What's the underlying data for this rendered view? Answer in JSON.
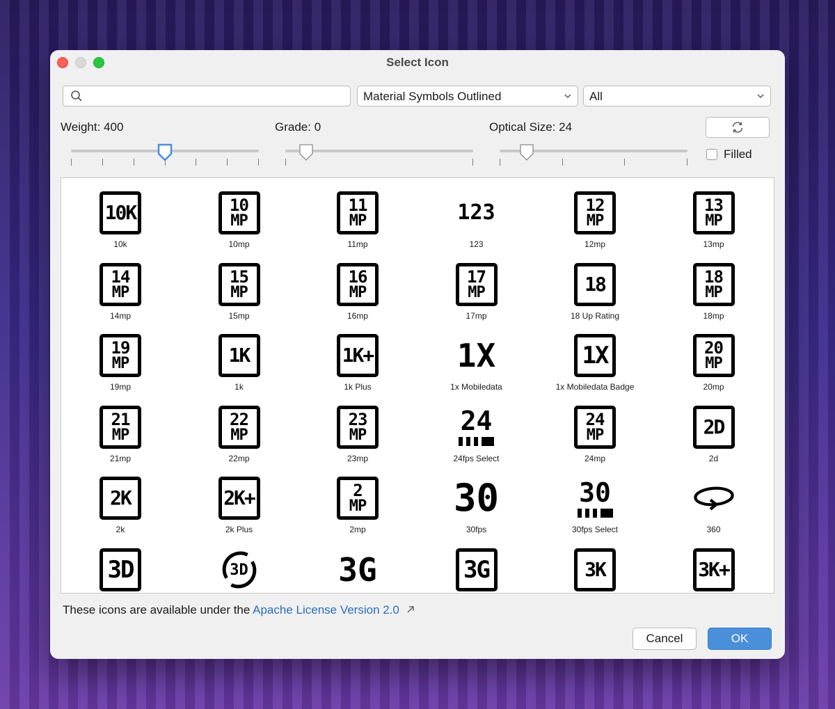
{
  "window": {
    "title": "Select Icon"
  },
  "search": {
    "placeholder": "",
    "value": ""
  },
  "icon_set": {
    "selected": "Material Symbols Outlined"
  },
  "category": {
    "selected": "All"
  },
  "sliders": {
    "weight": {
      "label": "Weight: 400",
      "value": 400,
      "min": 100,
      "max": 700
    },
    "grade": {
      "label": "Grade: 0",
      "value": 0,
      "min": -25,
      "max": 200
    },
    "optical_size": {
      "label": "Optical Size: 24",
      "value": 24,
      "min": 20,
      "max": 48
    }
  },
  "filled": {
    "label": "Filled",
    "checked": false
  },
  "icons": [
    {
      "label": "10k",
      "style": "boxed1",
      "text": "10K"
    },
    {
      "label": "10mp",
      "style": "boxed2",
      "top": "10",
      "bot": "MP"
    },
    {
      "label": "11mp",
      "style": "boxed2",
      "top": "11",
      "bot": "MP"
    },
    {
      "label": "123",
      "style": "plain",
      "text": "123"
    },
    {
      "label": "12mp",
      "style": "boxed2",
      "top": "12",
      "bot": "MP"
    },
    {
      "label": "13mp",
      "style": "boxed2",
      "top": "13",
      "bot": "MP"
    },
    {
      "label": "14mp",
      "style": "boxed2",
      "top": "14",
      "bot": "MP"
    },
    {
      "label": "15mp",
      "style": "boxed2",
      "top": "15",
      "bot": "MP"
    },
    {
      "label": "16mp",
      "style": "boxed2",
      "top": "16",
      "bot": "MP"
    },
    {
      "label": "17mp",
      "style": "boxed2",
      "top": "17",
      "bot": "MP"
    },
    {
      "label": "18 Up Rating",
      "style": "boxed1",
      "text": "18"
    },
    {
      "label": "18mp",
      "style": "boxed2",
      "top": "18",
      "bot": "MP"
    },
    {
      "label": "19mp",
      "style": "boxed2",
      "top": "19",
      "bot": "MP"
    },
    {
      "label": "1k",
      "style": "boxed1",
      "text": "1K"
    },
    {
      "label": "1k Plus",
      "style": "boxed1",
      "text": "1K+"
    },
    {
      "label": "1x Mobiledata",
      "style": "plain",
      "text": "1X"
    },
    {
      "label": "1x Mobiledata Badge",
      "style": "boxed1wide",
      "text": "1X"
    },
    {
      "label": "20mp",
      "style": "boxed2",
      "top": "20",
      "bot": "MP"
    },
    {
      "label": "21mp",
      "style": "boxed2",
      "top": "21",
      "bot": "MP"
    },
    {
      "label": "22mp",
      "style": "boxed2",
      "top": "22",
      "bot": "MP"
    },
    {
      "label": "23mp",
      "style": "boxed2",
      "top": "23",
      "bot": "MP"
    },
    {
      "label": "24fps Select",
      "style": "fps",
      "text": "24"
    },
    {
      "label": "24mp",
      "style": "boxed2",
      "top": "24",
      "bot": "MP"
    },
    {
      "label": "2d",
      "style": "boxed1",
      "text": "2D"
    },
    {
      "label": "2k",
      "style": "boxed1",
      "text": "2K"
    },
    {
      "label": "2k Plus",
      "style": "boxed1",
      "text": "2K+"
    },
    {
      "label": "2mp",
      "style": "boxed2",
      "top": "2",
      "bot": "MP"
    },
    {
      "label": "30fps",
      "style": "plainbig",
      "text": "30"
    },
    {
      "label": "30fps Select",
      "style": "fps",
      "text": "30"
    },
    {
      "label": "360",
      "style": "rotate360",
      "text": ""
    },
    {
      "label": "",
      "style": "boxed1wide",
      "text": "3D"
    },
    {
      "label": "",
      "style": "rotate3d",
      "text": "3D"
    },
    {
      "label": "",
      "style": "plain",
      "text": "3G"
    },
    {
      "label": "",
      "style": "boxed1wide",
      "text": "3G"
    },
    {
      "label": "",
      "style": "boxed1",
      "text": "3K"
    },
    {
      "label": "",
      "style": "boxed1",
      "text": "3K+"
    }
  ],
  "footer": {
    "text": "These icons are available under the ",
    "link": "Apache License Version 2.0",
    "link_icon": "external-link-icon"
  },
  "buttons": {
    "cancel": "Cancel",
    "ok": "OK"
  },
  "colors": {
    "accent": "#4a8fd9",
    "link": "#2a6ebb",
    "close": "#fe5f57",
    "maximize": "#28c840"
  }
}
